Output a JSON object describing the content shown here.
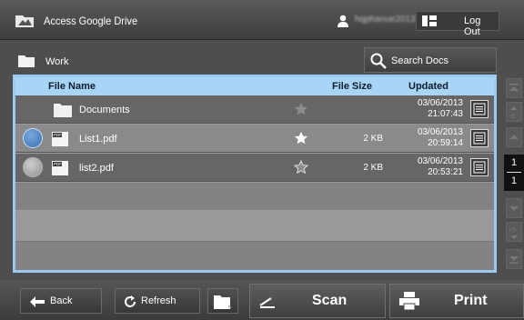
{
  "header": {
    "title": "Access Google Drive",
    "user_name": "hqphanue2013",
    "logout_label": "Log Out"
  },
  "folder": {
    "name": "Work"
  },
  "search": {
    "label": "Search Docs"
  },
  "table": {
    "columns": [
      "File Name",
      "File Size",
      "Updated"
    ],
    "rows": [
      {
        "name": "Documents",
        "type": "folder",
        "size": "",
        "date": "03/06/2013",
        "time": "21:07:43",
        "starred": false,
        "selected": null
      },
      {
        "name": "List1.pdf",
        "type": "pdf",
        "size": "2 KB",
        "date": "03/06/2013",
        "time": "20:59:14",
        "starred": true,
        "selected": true
      },
      {
        "name": "list2.pdf",
        "type": "pdf",
        "size": "2 KB",
        "date": "03/06/2013",
        "time": "20:53:21",
        "starred": false,
        "selected": false
      }
    ],
    "file_icon_text": "PDF"
  },
  "pager": {
    "current": "1",
    "total": "1",
    "prev_step": "-5",
    "next_step": "+5"
  },
  "footer": {
    "back_label": "Back",
    "refresh_label": "Refresh",
    "scan_label": "Scan",
    "print_label": "Print"
  },
  "colors": {
    "header_row": "#a8d5f6",
    "table_border": "#9bc9ef",
    "radio_selected": "#3a6fb0"
  }
}
